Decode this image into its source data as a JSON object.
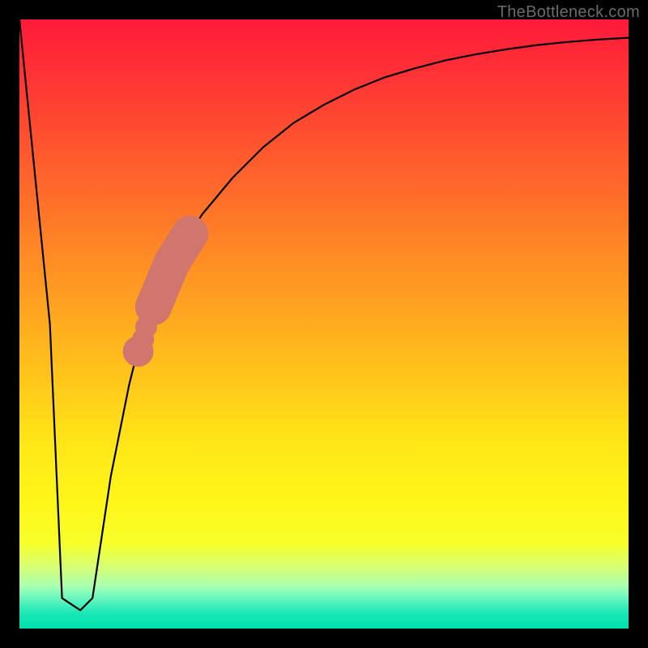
{
  "watermark": "TheBottleneck.com",
  "chart_data": {
    "type": "line",
    "title": "",
    "xlabel": "",
    "ylabel": "",
    "xlim": [
      0,
      100
    ],
    "ylim": [
      0,
      100
    ],
    "grid": false,
    "series": [
      {
        "name": "curve",
        "stroke": "#000000",
        "x": [
          0,
          5,
          7,
          10,
          12,
          15,
          18,
          20,
          25,
          30,
          35,
          40,
          45,
          50,
          55,
          60,
          65,
          70,
          75,
          80,
          85,
          90,
          95,
          100
        ],
        "values": [
          100,
          50,
          5,
          3,
          5,
          25,
          40,
          48,
          60,
          68,
          74,
          79,
          83,
          86,
          88.5,
          90.5,
          92,
          93.3,
          94.3,
          95.1,
          95.8,
          96.3,
          96.7,
          97
        ]
      }
    ],
    "highlight": {
      "type": "segment",
      "color": "#d1766c",
      "band_x": [
        22,
        28
      ],
      "band_y": [
        54,
        65
      ],
      "dots": [
        {
          "x": 21.5,
          "y": 52,
          "r": 1.2
        },
        {
          "x": 20.8,
          "y": 49.5,
          "r": 1.0
        },
        {
          "x": 20.3,
          "y": 47.5,
          "r": 1.0
        },
        {
          "x": 19.5,
          "y": 45.5,
          "r": 1.4
        }
      ],
      "band_width": 3.0
    }
  }
}
